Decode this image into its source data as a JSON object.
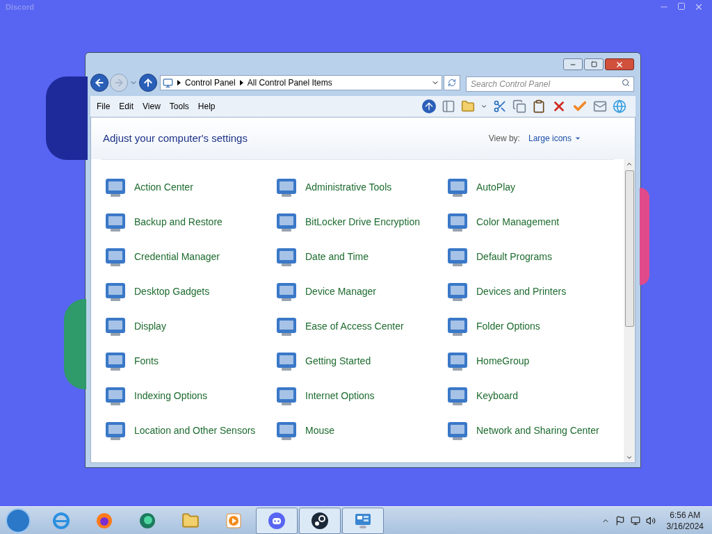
{
  "app_title": "Discord",
  "window": {
    "breadcrumb": [
      "Control Panel",
      "All Control Panel Items"
    ],
    "search": {
      "placeholder": "Search Control Panel"
    },
    "menu": [
      "File",
      "Edit",
      "View",
      "Tools",
      "Help"
    ],
    "heading": "Adjust your computer's settings",
    "view_by": {
      "label": "View by:",
      "value": "Large icons"
    },
    "items": [
      {
        "label": "Action Center"
      },
      {
        "label": "Administrative Tools"
      },
      {
        "label": "AutoPlay"
      },
      {
        "label": "Backup and Restore"
      },
      {
        "label": "BitLocker Drive Encryption"
      },
      {
        "label": "Color Management"
      },
      {
        "label": "Credential Manager"
      },
      {
        "label": "Date and Time"
      },
      {
        "label": "Default Programs"
      },
      {
        "label": "Desktop Gadgets"
      },
      {
        "label": "Device Manager"
      },
      {
        "label": "Devices and Printers"
      },
      {
        "label": "Display"
      },
      {
        "label": "Ease of Access Center"
      },
      {
        "label": "Folder Options"
      },
      {
        "label": "Fonts"
      },
      {
        "label": "Getting Started"
      },
      {
        "label": "HomeGroup"
      },
      {
        "label": "Indexing Options"
      },
      {
        "label": "Internet Options"
      },
      {
        "label": "Keyboard"
      },
      {
        "label": "Location and Other Sensors"
      },
      {
        "label": "Mouse"
      },
      {
        "label": "Network and Sharing Center"
      }
    ]
  },
  "taskbar": {
    "apps": [
      {
        "kind": "browser-e",
        "running": false
      },
      {
        "kind": "fox",
        "running": false
      },
      {
        "kind": "bubble",
        "running": false
      },
      {
        "kind": "folder",
        "running": false
      },
      {
        "kind": "media",
        "running": false
      },
      {
        "kind": "discord",
        "running": true
      },
      {
        "kind": "steam",
        "running": true
      },
      {
        "kind": "panel",
        "running": true
      }
    ],
    "time": "6:56 AM",
    "date": "3/16/2024"
  }
}
